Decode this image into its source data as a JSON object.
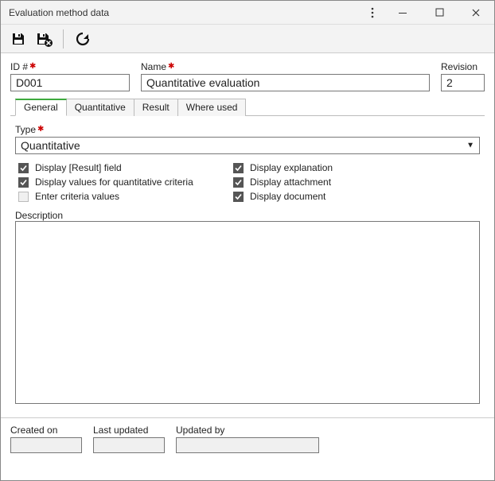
{
  "window": {
    "title": "Evaluation method data"
  },
  "header": {
    "id_label": "ID #",
    "id_value": "D001",
    "name_label": "Name",
    "name_value": "Quantitative evaluation",
    "revision_label": "Revision",
    "revision_value": "2"
  },
  "tabs": {
    "general": "General",
    "quantitative": "Quantitative",
    "result": "Result",
    "where_used": "Where used"
  },
  "general_tab": {
    "type_label": "Type",
    "type_value": "Quantitative",
    "checks": {
      "display_result_field": {
        "label": "Display [Result] field",
        "checked": true
      },
      "display_values_quant": {
        "label": "Display values for quantitative criteria",
        "checked": true
      },
      "enter_criteria_values": {
        "label": "Enter criteria values",
        "checked": false
      },
      "display_explanation": {
        "label": "Display explanation",
        "checked": true
      },
      "display_attachment": {
        "label": "Display attachment",
        "checked": true
      },
      "display_document": {
        "label": "Display document",
        "checked": true
      }
    },
    "description_label": "Description",
    "description_value": ""
  },
  "footer": {
    "created_on_label": "Created on",
    "created_on_value": "",
    "last_updated_label": "Last updated",
    "last_updated_value": "",
    "updated_by_label": "Updated by",
    "updated_by_value": ""
  }
}
